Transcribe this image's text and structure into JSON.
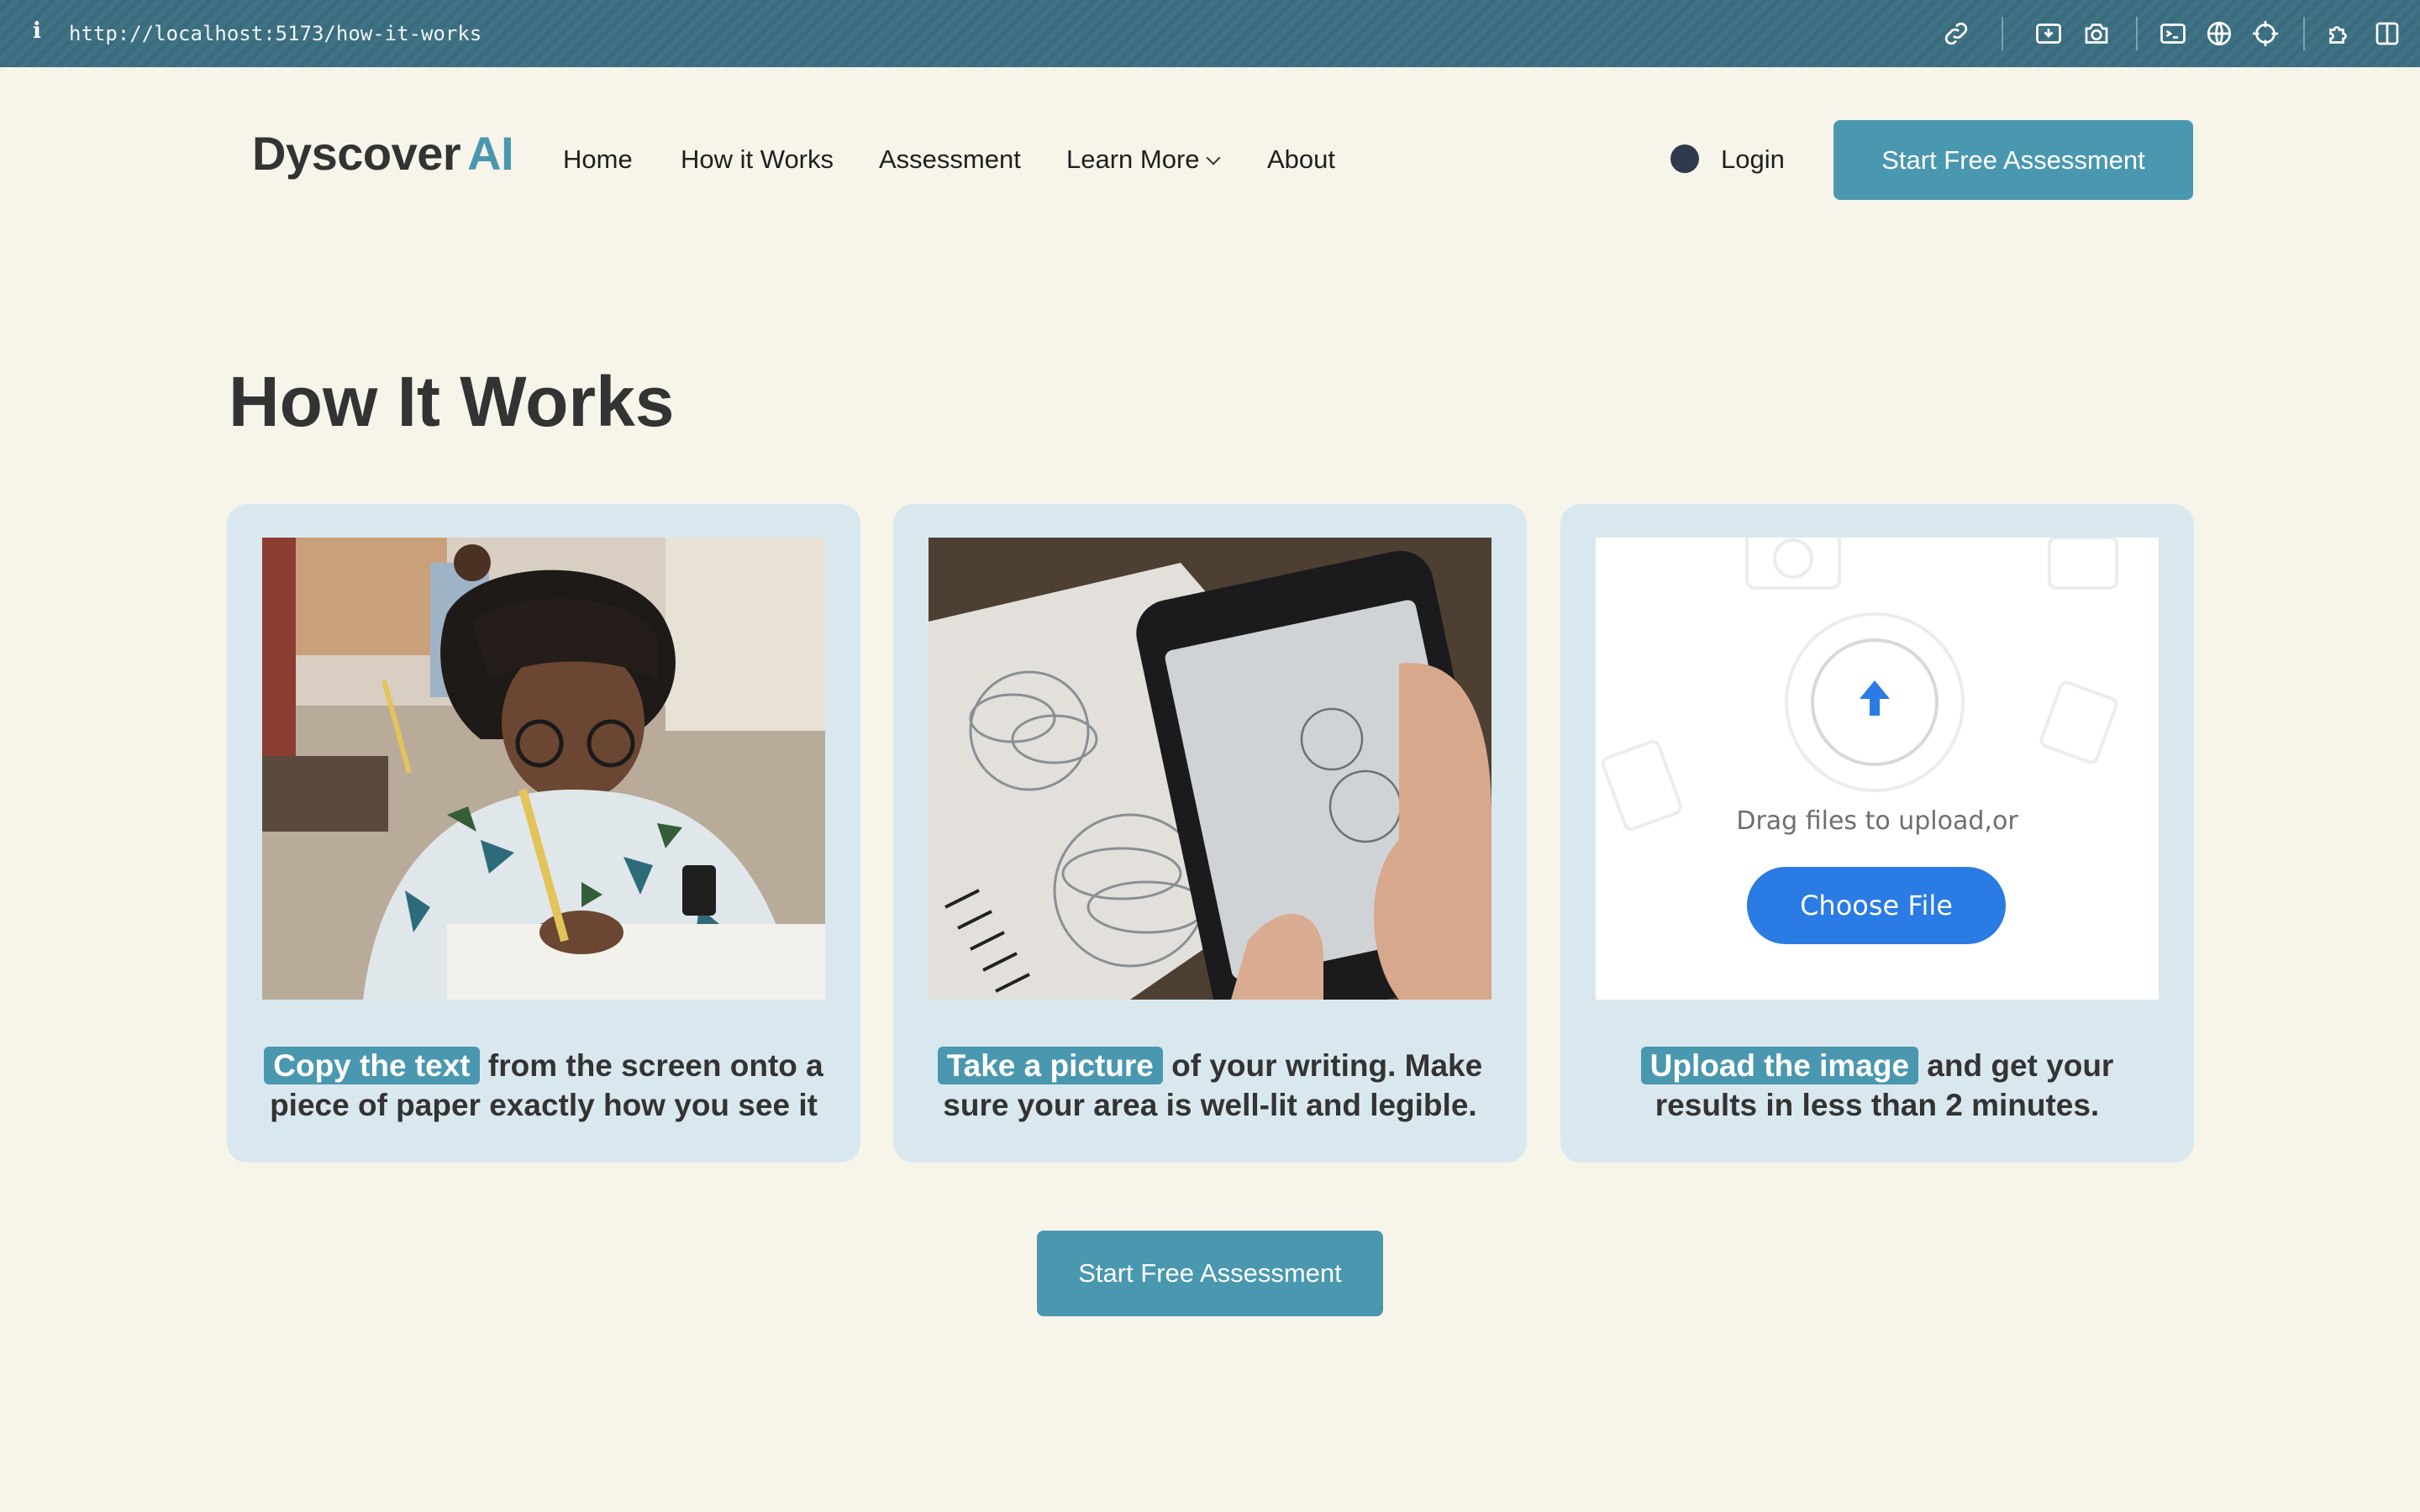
{
  "browser": {
    "url": "http://localhost:5173/how-it-works",
    "icons": [
      "info-icon",
      "link-icon",
      "download-icon",
      "camera-icon",
      "terminal-icon",
      "globe-icon",
      "crosshair-icon",
      "extensions-icon",
      "sidebar-icon"
    ]
  },
  "header": {
    "logo_part1": "Dyscover",
    "logo_part2": "AI",
    "nav": [
      {
        "label": "Home"
      },
      {
        "label": "How it Works"
      },
      {
        "label": "Assessment"
      },
      {
        "label": "Learn More"
      },
      {
        "label": "About"
      }
    ],
    "login": "Login",
    "cta": "Start Free Assessment"
  },
  "main": {
    "title": "How It Works",
    "steps": [
      {
        "highlight": "Copy the text",
        "text": " from the screen onto a piece of paper exactly how you see it"
      },
      {
        "highlight": "Take a picture",
        "text": " of your writing. Make sure your area is well-lit and legible."
      },
      {
        "highlight": "Upload the image",
        "text": " and get your results in less than 2 minutes."
      }
    ],
    "upload_demo": {
      "drag_text": "Drag files to upload,or",
      "choose_button": "Choose File"
    },
    "cta": "Start Free Assessment"
  },
  "colors": {
    "accent": "#4a97b0",
    "background": "#f7f4ea",
    "card": "#d9e8ee",
    "browser_bar": "#3f7284"
  }
}
